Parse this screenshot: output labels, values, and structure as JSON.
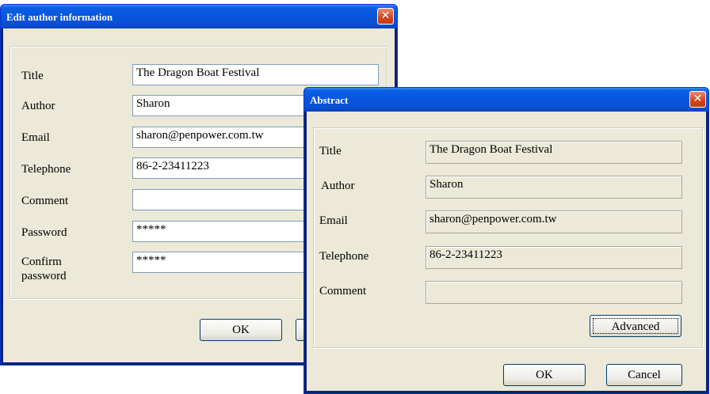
{
  "edit_author": {
    "title": "Edit author information",
    "labels": {
      "title": "Title",
      "author": "Author",
      "email": "Email",
      "telephone": "Telephone",
      "comment": "Comment",
      "password": "Password",
      "confirm_line1": "Confirm",
      "confirm_line2": "password"
    },
    "values": {
      "title": "The Dragon Boat Festival",
      "author": "Sharon",
      "email": "sharon@penpower.com.tw",
      "telephone": "86-2-23411223",
      "comment": "",
      "password": "*****",
      "confirm": "*****"
    },
    "ok_label": "OK"
  },
  "abstract": {
    "title": "Abstract",
    "labels": {
      "title": "Title",
      "author": "Author",
      "email": "Email",
      "telephone": "Telephone",
      "comment": "Comment"
    },
    "values": {
      "title": "The Dragon Boat Festival",
      "author": "Sharon",
      "email": "sharon@penpower.com.tw",
      "telephone": "86-2-23411223",
      "comment": ""
    },
    "advanced_label": "Advanced",
    "ok_label": "OK",
    "cancel_label": "Cancel"
  },
  "icons": {
    "close": "close-icon"
  },
  "colors": {
    "titlebar": "#0855dd",
    "dialog_bg": "#ece9d8",
    "close_button": "#d2451d"
  }
}
